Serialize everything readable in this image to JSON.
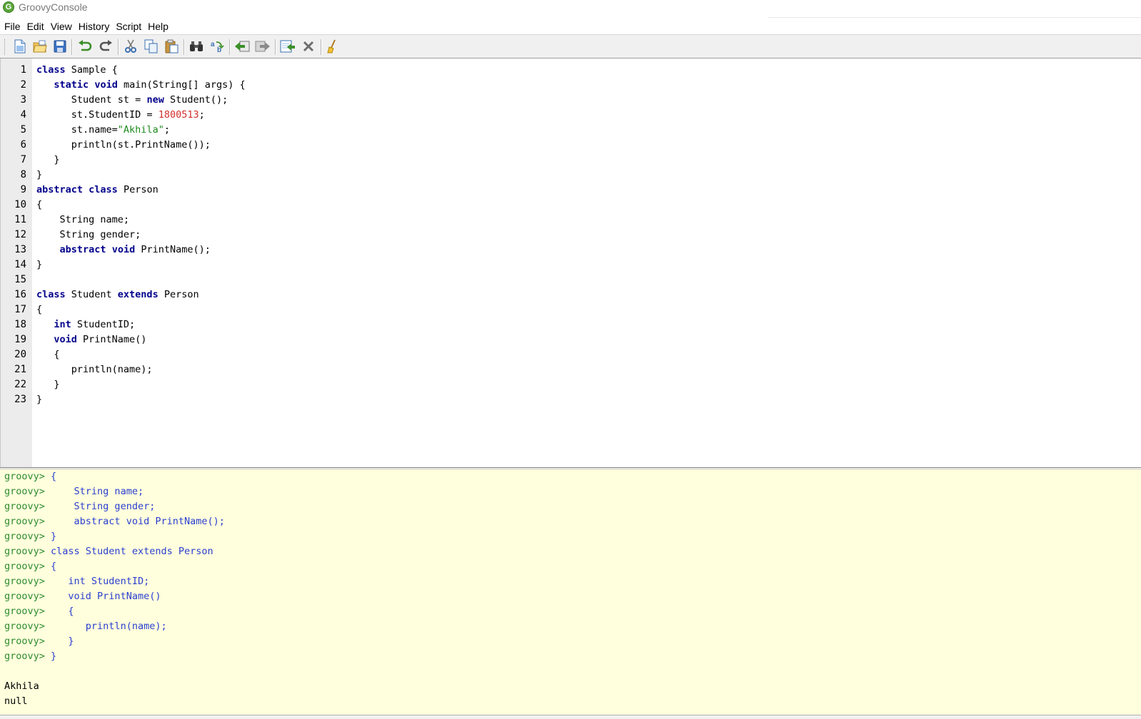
{
  "window": {
    "title": "GroovyConsole",
    "app_icon_letter": "G"
  },
  "menu": [
    "File",
    "Edit",
    "View",
    "History",
    "Script",
    "Help"
  ],
  "toolbar": {
    "buttons": [
      {
        "name": "new-file-icon"
      },
      {
        "name": "open-file-icon"
      },
      {
        "name": "save-file-icon"
      },
      {
        "name": "undo-icon"
      },
      {
        "name": "redo-icon"
      },
      {
        "name": "cut-icon"
      },
      {
        "name": "copy-icon"
      },
      {
        "name": "paste-icon"
      },
      {
        "name": "find-icon"
      },
      {
        "name": "replace-icon"
      },
      {
        "name": "history-previous-icon"
      },
      {
        "name": "history-next-icon"
      },
      {
        "name": "run-script-icon"
      },
      {
        "name": "interrupt-script-icon"
      },
      {
        "name": "clear-output-icon"
      }
    ]
  },
  "editor": {
    "lines": [
      [
        [
          "kw",
          "class"
        ],
        [
          "t",
          " Sample {"
        ]
      ],
      [
        [
          "t",
          "   "
        ],
        [
          "kw",
          "static"
        ],
        [
          "t",
          " "
        ],
        [
          "kw",
          "void"
        ],
        [
          "t",
          " main(String[] args) {"
        ]
      ],
      [
        [
          "t",
          "      Student st = "
        ],
        [
          "kw",
          "new"
        ],
        [
          "t",
          " Student();"
        ]
      ],
      [
        [
          "t",
          "      st.StudentID = "
        ],
        [
          "num",
          "1800513"
        ],
        [
          "t",
          ";"
        ]
      ],
      [
        [
          "t",
          "      st.name="
        ],
        [
          "str",
          "\"Akhila\""
        ],
        [
          "t",
          ";"
        ]
      ],
      [
        [
          "t",
          "      println(st.PrintName());"
        ]
      ],
      [
        [
          "t",
          "   }"
        ]
      ],
      [
        [
          "t",
          "}"
        ]
      ],
      [
        [
          "kw",
          "abstract"
        ],
        [
          "t",
          " "
        ],
        [
          "kw",
          "class"
        ],
        [
          "t",
          " Person"
        ]
      ],
      [
        [
          "t",
          "{"
        ]
      ],
      [
        [
          "t",
          "    String name;"
        ]
      ],
      [
        [
          "t",
          "    String gender;"
        ]
      ],
      [
        [
          "t",
          "    "
        ],
        [
          "kw",
          "abstract"
        ],
        [
          "t",
          " "
        ],
        [
          "kw",
          "void"
        ],
        [
          "t",
          " PrintName();"
        ]
      ],
      [
        [
          "t",
          "}"
        ]
      ],
      [
        [
          "t",
          ""
        ]
      ],
      [
        [
          "kw",
          "class"
        ],
        [
          "t",
          " Student "
        ],
        [
          "kw",
          "extends"
        ],
        [
          "t",
          " Person"
        ]
      ],
      [
        [
          "t",
          "{"
        ]
      ],
      [
        [
          "t",
          "   "
        ],
        [
          "kw",
          "int"
        ],
        [
          "t",
          " StudentID;"
        ]
      ],
      [
        [
          "t",
          "   "
        ],
        [
          "kw",
          "void"
        ],
        [
          "t",
          " PrintName()"
        ]
      ],
      [
        [
          "t",
          "   {"
        ]
      ],
      [
        [
          "t",
          "      println(name);"
        ]
      ],
      [
        [
          "t",
          "   }"
        ]
      ],
      [
        [
          "t",
          "}"
        ]
      ]
    ]
  },
  "output": {
    "lines": [
      {
        "prompt": "groovy> ",
        "text": "{"
      },
      {
        "prompt": "groovy> ",
        "text": "    String name;"
      },
      {
        "prompt": "groovy> ",
        "text": "    String gender;"
      },
      {
        "prompt": "groovy> ",
        "text": "    abstract void PrintName();"
      },
      {
        "prompt": "groovy> ",
        "text": "}"
      },
      {
        "prompt": "groovy> ",
        "text": "class Student extends Person"
      },
      {
        "prompt": "groovy> ",
        "text": "{"
      },
      {
        "prompt": "groovy> ",
        "text": "   int StudentID;"
      },
      {
        "prompt": "groovy> ",
        "text": "   void PrintName()"
      },
      {
        "prompt": "groovy> ",
        "text": "   {"
      },
      {
        "prompt": "groovy> ",
        "text": "      println(name);"
      },
      {
        "prompt": "groovy> ",
        "text": "   }"
      },
      {
        "prompt": "groovy> ",
        "text": "}"
      },
      {
        "prompt": "",
        "text": ""
      },
      {
        "prompt": "",
        "text": "Akhila",
        "result": true
      },
      {
        "prompt": "",
        "text": "null",
        "result": true
      }
    ]
  },
  "colors": {
    "keyword": "#00008b",
    "number": "#d2302b",
    "string": "#1e8a1e",
    "prompt": "#2e8b2e",
    "echo": "#2b3fd0",
    "output_bg": "#ffffdd",
    "gutter_bg": "#ececec"
  }
}
